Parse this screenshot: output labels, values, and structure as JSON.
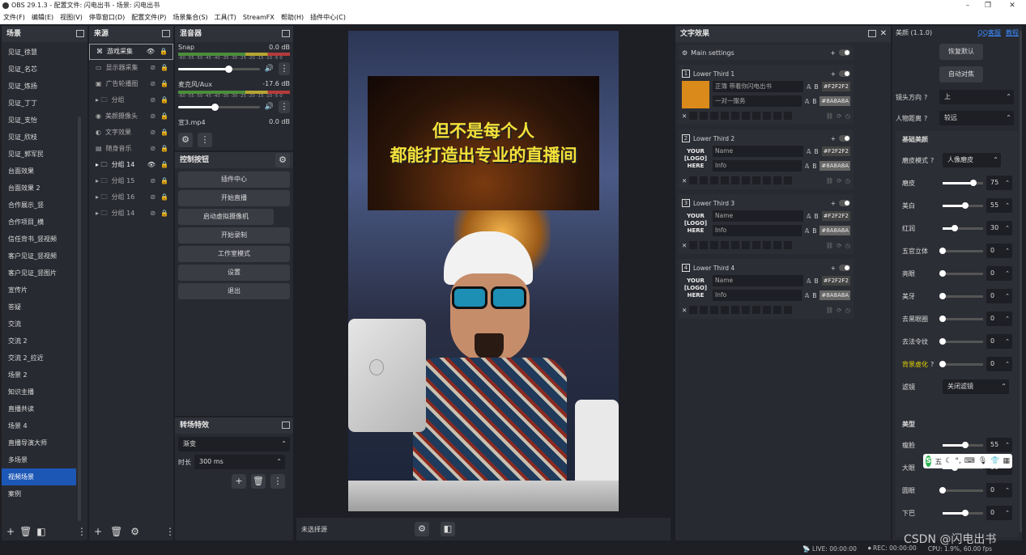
{
  "window": {
    "title": "OBS 29.1.3 - 配置文件: 闪电出书 - 场景: 闪电出书"
  },
  "menu": [
    "文件(F)",
    "编辑(E)",
    "视图(V)",
    "停靠窗口(D)",
    "配置文件(P)",
    "场景集合(S)",
    "工具(T)",
    "StreamFX",
    "帮助(H)",
    "插件中心(C)"
  ],
  "scenes": {
    "title": "场景",
    "items": [
      "见证_徐慧",
      "见证_名芯",
      "见证_炼扬",
      "见证_丁丁",
      "见证_支怡",
      "见证_欣枝",
      "见证_郭军民",
      "台面效果",
      "台面效果 2",
      "合作展示_竖",
      "合作项目_横",
      "信任背书_竖视频",
      "客户见证_竖视频",
      "客户见证_竖图片",
      "宣传片",
      "答疑",
      "交流",
      "交流 2",
      "交流 2_拉近",
      "场景 2",
      "知识主播",
      "直播共读",
      "场景 4",
      "直播导演大师",
      "多场景",
      "视频场景",
      "案例"
    ],
    "selected_index": 25
  },
  "sources": {
    "title": "来源",
    "items": [
      {
        "label": "游戏采集",
        "icon": "gamepad-icon",
        "active": true
      },
      {
        "label": "显示器采集",
        "icon": "monitor-icon",
        "active": false
      },
      {
        "label": "广告轮播图",
        "icon": "image-slideshow-icon",
        "active": false
      },
      {
        "label": "分组",
        "icon": "folder-icon",
        "active": false
      },
      {
        "label": "美颜摄像头",
        "icon": "camera-icon",
        "active": false
      },
      {
        "label": "文字效果",
        "icon": "text-icon",
        "active": false
      },
      {
        "label": "随身音乐",
        "icon": "browser-icon",
        "active": false
      },
      {
        "label": "分组 14",
        "icon": "folder-icon",
        "active": true
      },
      {
        "label": "分组 15",
        "icon": "folder-icon",
        "active": false
      },
      {
        "label": "分组 16",
        "icon": "folder-icon",
        "active": false
      },
      {
        "label": "分组 14",
        "icon": "folder-icon",
        "active": false
      }
    ]
  },
  "mixer": {
    "title": "混音器",
    "channels": [
      {
        "name": "Snap",
        "db": "0.0 dB",
        "level": 0.62
      },
      {
        "name": "麦克风/Aux",
        "db": "-17.6 dB",
        "level": 0.45
      },
      {
        "name": "宣3.mp4",
        "db": "0.0 dB",
        "level": 0.0
      }
    ],
    "scale": "-60 -55 -50 -45 -40 -35 -30 -25 -20 -15 -10 -5 0"
  },
  "controls": {
    "title": "控制按钮",
    "buttons": [
      "插件中心",
      "开始直播",
      "启动虚拟摄像机",
      "开始录制",
      "工作室模式",
      "设置",
      "退出"
    ]
  },
  "transitions": {
    "title": "转场特效",
    "type": "渐变",
    "duration_label": "时长",
    "duration": "300 ms"
  },
  "preview": {
    "line1": "但不是每个人",
    "line2": "都能打造出专业的直播间",
    "bottom_label": "未选择源"
  },
  "text_effects": {
    "title": "文字效果",
    "main_settings": "Main settings",
    "lower_thirds": [
      {
        "num": "1",
        "name": "Lower Third 1",
        "title": "正簿 带着你闪电出书",
        "subtitle": "一对一服务",
        "color1": "#F2F2F2",
        "color2": "#8A8A8A"
      },
      {
        "num": "2",
        "name": "Lower Third 2",
        "title": "Name",
        "subtitle": "Info",
        "color1": "#F2F2F2",
        "color2": "#8A8A8A",
        "logo": "YOUR\n[LOGO]\nHERE"
      },
      {
        "num": "3",
        "name": "Lower Third 3",
        "title": "Name",
        "subtitle": "Info",
        "color1": "#F2F2F2",
        "color2": "#8A8A8A",
        "logo": "YOUR\n[LOGO]\nHERE"
      },
      {
        "num": "4",
        "name": "Lower Third 4",
        "title": "Name",
        "subtitle": "Info",
        "color1": "#F2F2F2",
        "color2": "#8A8A8A",
        "logo": "YOUR\n[LOGO]\nHERE"
      }
    ]
  },
  "beauty": {
    "title": "美颜 (1.1.0)",
    "link1": "QQ客服",
    "link2": "教程",
    "reset": "恢复默认",
    "auto": "自动对焦",
    "lens_label": "镜头方向",
    "lens_value": "上",
    "distance_label": "人物距离",
    "distance_value": "较远",
    "basic_title": "基础美颜",
    "smooth_mode_label": "磨皮模式",
    "smooth_mode_value": "人像磨皮",
    "basic": [
      {
        "label": "磨皮",
        "value": "75",
        "fill": 0.75
      },
      {
        "label": "美白",
        "value": "55",
        "fill": 0.55
      },
      {
        "label": "红润",
        "value": "30",
        "fill": 0.3
      },
      {
        "label": "五官立体",
        "value": "0",
        "fill": 0
      },
      {
        "label": "亮眼",
        "value": "0",
        "fill": 0
      },
      {
        "label": "美牙",
        "value": "0",
        "fill": 0
      },
      {
        "label": "去黑眼圈",
        "value": "0",
        "fill": 0
      },
      {
        "label": "去法令纹",
        "value": "0",
        "fill": 0
      },
      {
        "label": "背景虚化",
        "value": "0",
        "fill": 0
      }
    ],
    "filter_label": "滤镜",
    "filter_value": "关闭滤镜",
    "shape_title": "美型",
    "shape": [
      {
        "label": "瘦脸",
        "value": "55",
        "fill": 0.55
      },
      {
        "label": "大眼",
        "value": "30",
        "fill": 0.3
      },
      {
        "label": "圆眼",
        "value": "0",
        "fill": 0
      },
      {
        "label": "下巴",
        "value": "0",
        "fill": 0.55
      }
    ]
  },
  "statusbar": {
    "live": "LIVE: 00:00:00",
    "rec": "REC: 00:00:00",
    "cpu": "CPU: 1.9%, 60.00 fps"
  },
  "watermark": "CSDN @闪电出书",
  "ime": "五"
}
